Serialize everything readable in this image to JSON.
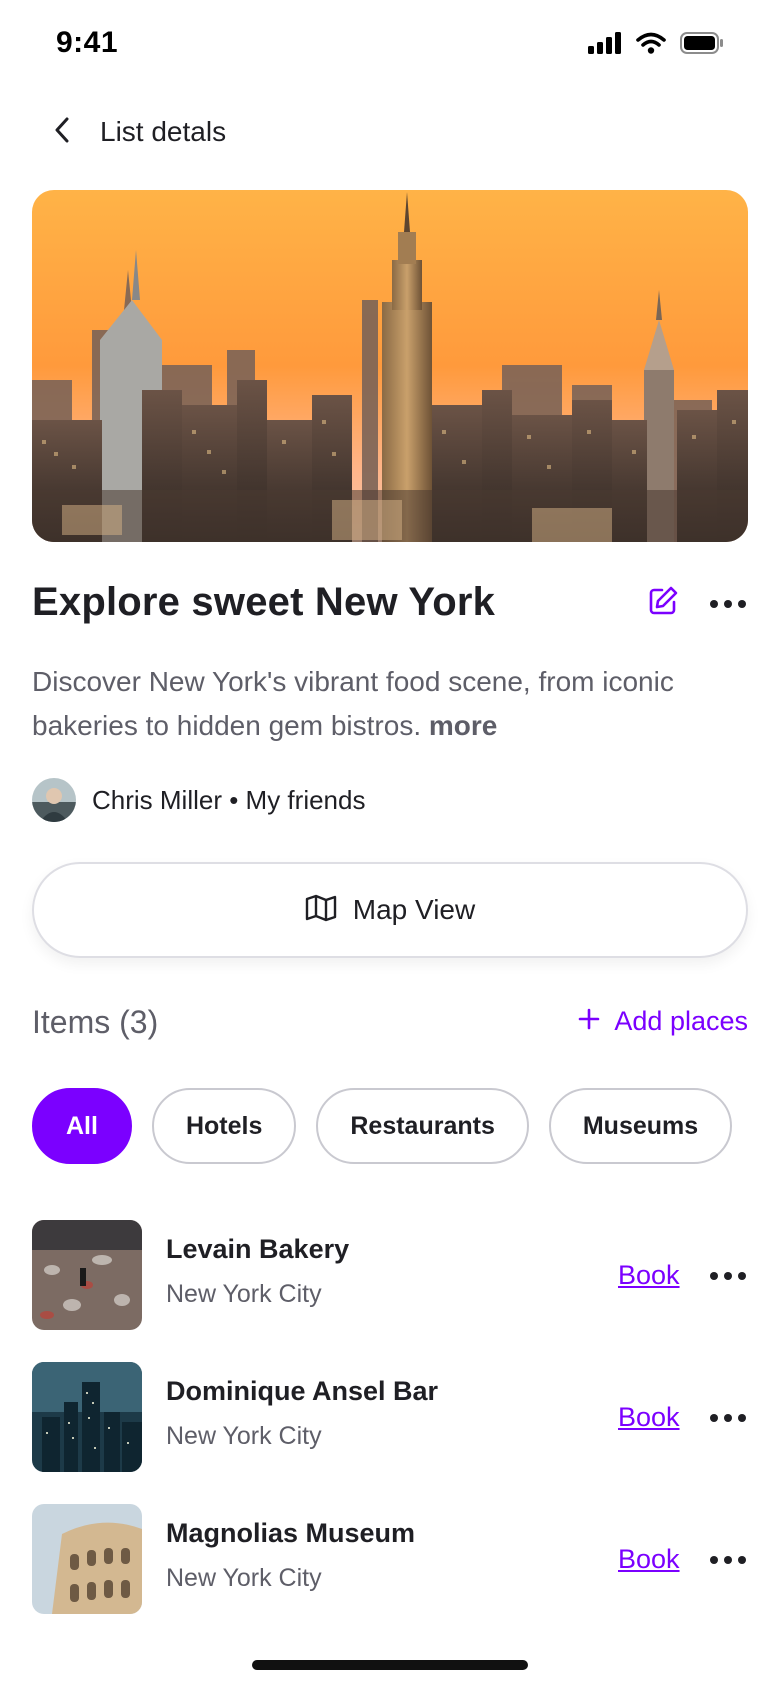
{
  "status_bar": {
    "time": "9:41",
    "icons": [
      "cellular-signal-icon",
      "wifi-icon",
      "battery-icon"
    ]
  },
  "header": {
    "back_icon": "chevron-left-icon",
    "title": "List detals"
  },
  "hero": {
    "image": "new-york-skyline-sunset"
  },
  "list": {
    "title": "Explore sweet New York",
    "edit_icon": "edit-pencil-icon",
    "more_icon": "more-horizontal-icon",
    "description": "Discover New York's vibrant food scene, from iconic bakeries to hidden gem bistros.",
    "description_more": "more",
    "owner_text": "Chris Miller • My friends"
  },
  "map_button": {
    "icon": "map-icon",
    "label": "Map View"
  },
  "items_section": {
    "heading": "Items (3)",
    "add_label": "Add places",
    "add_icon": "plus-icon"
  },
  "filters": {
    "selected": "All",
    "chips": [
      "All",
      "Hotels",
      "Restaurants",
      "Museums"
    ]
  },
  "items": [
    {
      "name": "Levain Bakery",
      "city": "New York City",
      "book_label": "Book",
      "thumb": "busy-street-crowd"
    },
    {
      "name": "Dominique Ansel Bar",
      "city": "New York City",
      "book_label": "Book",
      "thumb": "night-city-towers"
    },
    {
      "name": "Magnolias Museum",
      "city": "New York City",
      "book_label": "Book",
      "thumb": "colosseum-arches"
    }
  ],
  "colors": {
    "accent": "#7b00ff",
    "text_primary": "#1f1f24",
    "text_secondary": "#5e5e68",
    "chip_border": "#c9c9d0"
  }
}
